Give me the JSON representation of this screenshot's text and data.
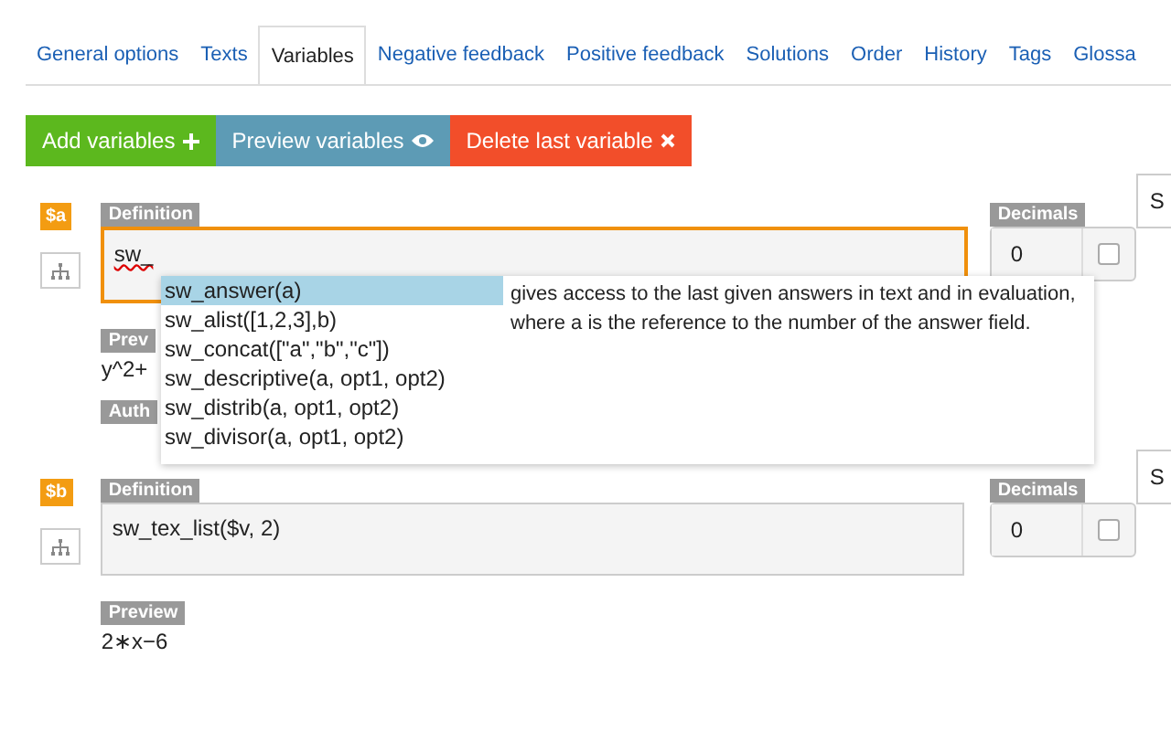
{
  "tabs": [
    {
      "label": "General options",
      "selected": false
    },
    {
      "label": "Texts",
      "selected": false
    },
    {
      "label": "Variables",
      "selected": true
    },
    {
      "label": "Negative feedback",
      "selected": false
    },
    {
      "label": "Positive feedback",
      "selected": false
    },
    {
      "label": "Solutions",
      "selected": false
    },
    {
      "label": "Order",
      "selected": false
    },
    {
      "label": "History",
      "selected": false
    },
    {
      "label": "Tags",
      "selected": false
    },
    {
      "label": "Glossa",
      "selected": false
    }
  ],
  "actions": [
    {
      "label": "Add variables",
      "kind": "add"
    },
    {
      "label": "Preview variables",
      "kind": "preview"
    },
    {
      "label": "Delete last variable",
      "kind": "delete"
    }
  ],
  "variables": [
    {
      "name": "$a",
      "definition_label": "Definition",
      "definition": "sw_",
      "focused": true,
      "decimals_label": "Decimals",
      "decimals": "0",
      "rounding_checked": false,
      "side_button": "S",
      "preview_label": "Prev",
      "preview": "y^2+",
      "author_label": "Auth",
      "autocomplete": {
        "items": [
          {
            "label": "sw_answer(a)",
            "selected": true
          },
          {
            "label": "sw_alist([1,2,3],b)",
            "selected": false
          },
          {
            "label": "sw_concat([\"a\",\"b\",\"c\"])",
            "selected": false
          },
          {
            "label": "sw_descriptive(a, opt1, opt2)",
            "selected": false
          },
          {
            "label": "sw_distrib(a, opt1, opt2)",
            "selected": false
          },
          {
            "label": "sw_divisor(a, opt1, opt2)",
            "selected": false
          }
        ],
        "description": "gives access to the last given answers in text and in evaluation, where a is the reference to the number of the answer field."
      }
    },
    {
      "name": "$b",
      "definition_label": "Definition",
      "definition": "sw_tex_list($v, 2)",
      "focused": false,
      "decimals_label": "Decimals",
      "decimals": "0",
      "rounding_checked": false,
      "side_button": "S",
      "preview_label": "Preview",
      "preview": "2∗x−6"
    }
  ]
}
